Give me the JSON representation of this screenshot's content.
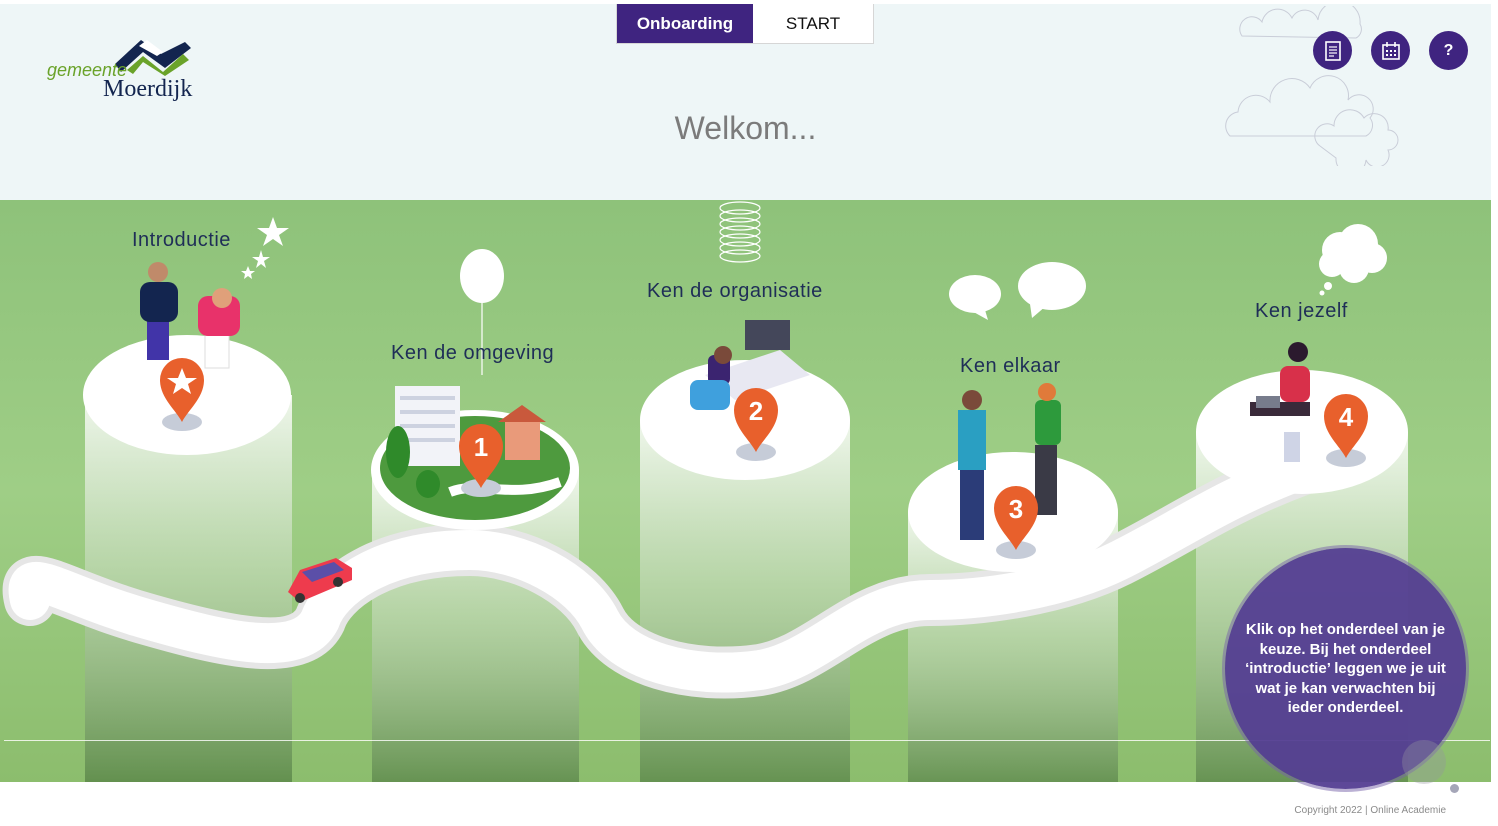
{
  "logo": {
    "line1": "gemeente",
    "line2": "Moerdijk"
  },
  "tabs": [
    {
      "label": "Onboarding",
      "active": true
    },
    {
      "label": "START",
      "active": false
    }
  ],
  "header": {
    "title": "Welkom..."
  },
  "toolbar": {
    "book_icon": "book-icon",
    "calendar_icon": "calendar-icon",
    "help_label": "?"
  },
  "stops": [
    {
      "label": "Introductie",
      "marker": "star"
    },
    {
      "label": "Ken de omgeving",
      "marker": "1"
    },
    {
      "label": "Ken de organisatie",
      "marker": "2"
    },
    {
      "label": "Ken elkaar",
      "marker": "3"
    },
    {
      "label": "Ken jezelf",
      "marker": "4"
    }
  ],
  "info": {
    "text": "Klik op het onderdeel van je keuze. Bij het onderdeel ‘introductie’ leggen we je uit wat je kan verwachten bij ieder onderdeel."
  },
  "footer": {
    "copyright": "Copyright 2022 | Online Academie"
  },
  "colors": {
    "primary": "#3f2480",
    "marker": "#e8602c",
    "label": "#1f2e57",
    "grass": "#9fce86"
  }
}
